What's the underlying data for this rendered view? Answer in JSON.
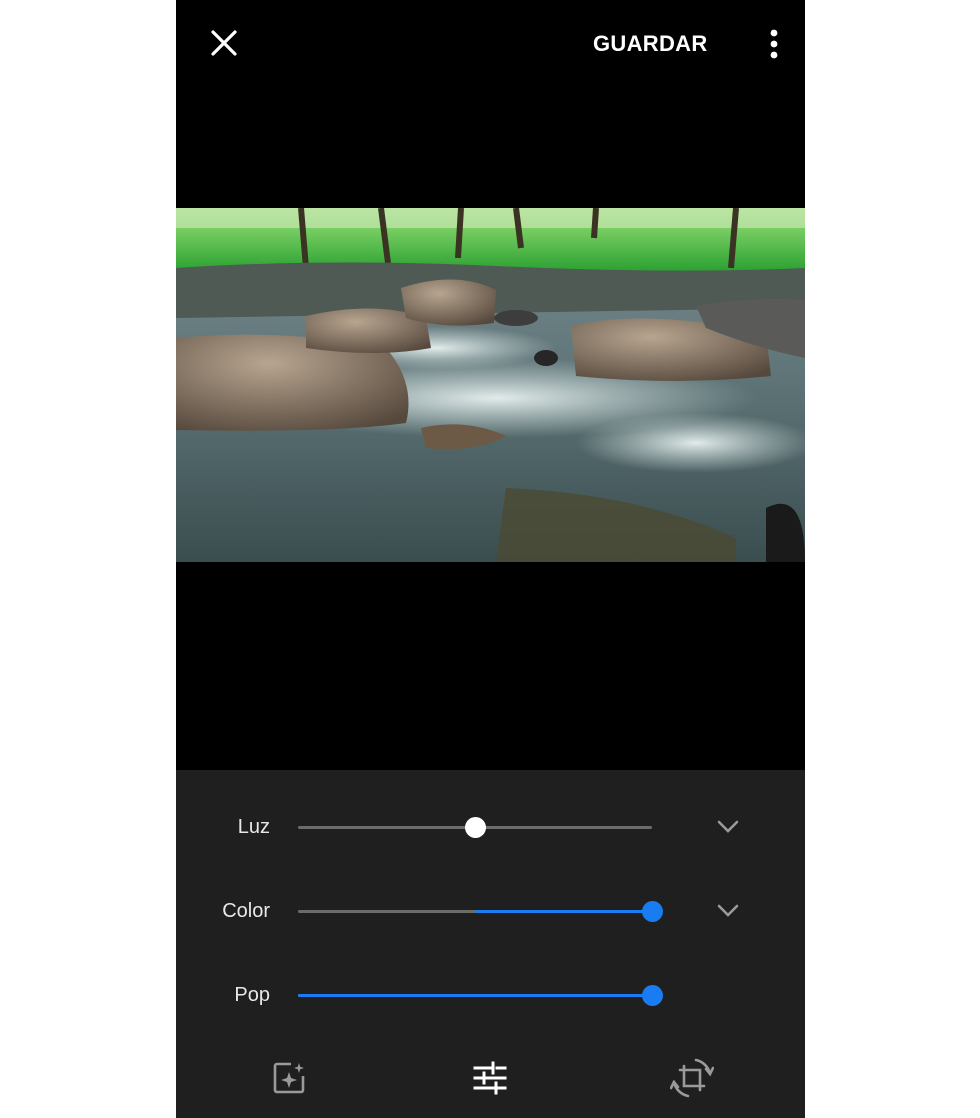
{
  "topbar": {
    "close_icon": "close-icon",
    "save_label": "GUARDAR",
    "more_icon": "more-vert-icon"
  },
  "image": {
    "description_icon": "photo-river-rocks"
  },
  "adjustments": {
    "luz": {
      "label": "Luz",
      "value": 0.5,
      "expand_icon": "chevron-down-icon"
    },
    "color": {
      "label": "Color",
      "value": 1.0,
      "expand_icon": "chevron-down-icon"
    },
    "pop": {
      "label": "Pop",
      "value": 1.0
    }
  },
  "toolbar": {
    "items": [
      "auto-enhance-icon",
      "adjust-sliders-icon",
      "crop-rotate-icon"
    ]
  },
  "colors": {
    "accent": "#1a7cf2",
    "panel": "#1f1f1f",
    "background": "#000000"
  }
}
